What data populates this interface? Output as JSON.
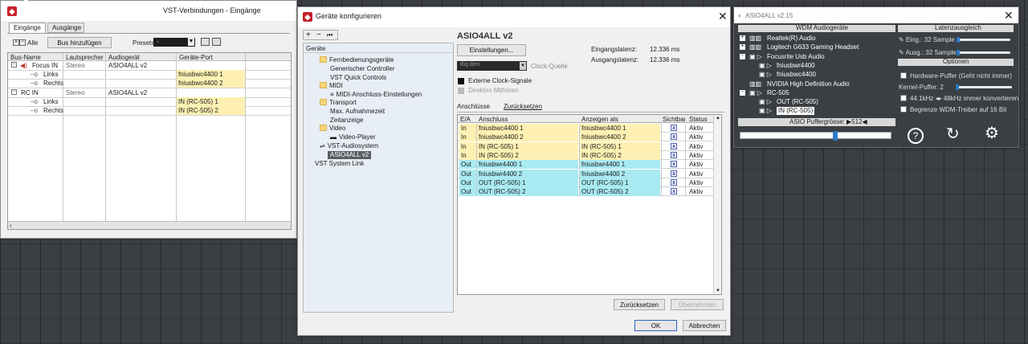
{
  "vst_window": {
    "title": "VST-Verbindungen - Eingänge",
    "tabs": [
      "Eingänge",
      "Ausgänge"
    ],
    "all_label": "Alle",
    "add_bus": "Bus hinzufügen",
    "presets_label": "Presets",
    "headers": [
      "Bus-Name",
      "Lautsprecher",
      "Audiogerät",
      "Geräte-Port"
    ],
    "rows": [
      {
        "name": "Focus IN",
        "speaker": "Stereo",
        "device": "ASIO4ALL v2",
        "port": ""
      },
      {
        "name": "Links",
        "speaker": "",
        "device": "",
        "port": "fniusbwc4400 1"
      },
      {
        "name": "Rechts",
        "speaker": "",
        "device": "",
        "port": "fniusbwc4400 2"
      },
      {
        "name": "RC IN",
        "speaker": "Stereo",
        "device": "ASIO4ALL v2",
        "port": ""
      },
      {
        "name": "Links",
        "speaker": "",
        "device": "",
        "port": "IN (RC-505) 1"
      },
      {
        "name": "Rechts",
        "speaker": "",
        "device": "",
        "port": "IN (RC-505) 2"
      }
    ]
  },
  "config_window": {
    "title": "Geräte konfigurieren",
    "tree_header": "Geräte",
    "tree": [
      {
        "label": "Fernbedienungsgeräte",
        "kind": "folder"
      },
      {
        "label": "Generischer Controller",
        "kind": "item"
      },
      {
        "label": "VST Quick Controls",
        "kind": "item"
      },
      {
        "label": "MIDI",
        "kind": "folder"
      },
      {
        "label": "MIDI-Anschluss-Einstellungen",
        "kind": "midi"
      },
      {
        "label": "Transport",
        "kind": "folder"
      },
      {
        "label": "Max. Aufnahmezeit",
        "kind": "item"
      },
      {
        "label": "Zeitanzeige",
        "kind": "item"
      },
      {
        "label": "Video",
        "kind": "folder"
      },
      {
        "label": "Video-Player",
        "kind": "video"
      },
      {
        "label": "VST-Audiosystem",
        "kind": "audio"
      },
      {
        "label": "ASIO4ALL v2",
        "kind": "selected"
      },
      {
        "label": "VST System Link",
        "kind": "top"
      }
    ],
    "device_title": "ASIO4ALL v2",
    "settings_button": "Einstellungen...",
    "input_latency_label": "Eingangslatenz:",
    "input_latency_value": "12.336 ms",
    "output_latency_label": "Ausgangslatenz:",
    "output_latency_value": "12.336 ms",
    "clock_source_value": "Big Ben",
    "clock_source_label": "Clock-Quelle",
    "external_clock": "Externe Clock-Signale",
    "direct_monitoring": "Direktes Mithören",
    "tab_ports": "Anschlüsse",
    "tab_reset": "Zurücksetzen",
    "port_headers": [
      "E/A",
      "Anschluss",
      "Anzeigen als",
      "Sichtbar",
      "Status"
    ],
    "ports": [
      {
        "io": "In",
        "port": "fniusbwc4400 1",
        "display": "fniusbwc4400 1",
        "visible": "x",
        "status": "Aktiv"
      },
      {
        "io": "In",
        "port": "fniusbwc4400 2",
        "display": "fniusbwc4400 2",
        "visible": "x",
        "status": "Aktiv"
      },
      {
        "io": "In",
        "port": "IN (RC-505) 1",
        "display": "IN (RC-505) 1",
        "visible": "x",
        "status": "Aktiv"
      },
      {
        "io": "In",
        "port": "IN (RC-505) 2",
        "display": "IN (RC-505) 2",
        "visible": "x",
        "status": "Aktiv"
      },
      {
        "io": "Out",
        "port": "fniusbwr4400 1",
        "display": "fniusbwr4400 1",
        "visible": "x",
        "status": "Aktiv"
      },
      {
        "io": "Out",
        "port": "fniusbwr4400 2",
        "display": "fniusbwr4400 2",
        "visible": "x",
        "status": "Aktiv"
      },
      {
        "io": "Out",
        "port": "OUT (RC-505) 1",
        "display": "OUT (RC-505) 1",
        "visible": "x",
        "status": "Aktiv"
      },
      {
        "io": "Out",
        "port": "OUT (RC-505) 2",
        "display": "OUT (RC-505) 2",
        "visible": "x",
        "status": "Aktiv"
      }
    ],
    "reset_button": "Zurücksetzen",
    "apply_button": "Übernehmen",
    "ok_button": "OK",
    "cancel_button": "Abbrechen"
  },
  "asio_window": {
    "title": "ASIO4ALL v2.15",
    "wdm_header": "WDM Audiogeräte",
    "latency_header": "Latenzausgleich",
    "devices": [
      {
        "label": "Realtek(R) Audio",
        "level": 0,
        "sign": "+"
      },
      {
        "label": "Logitech G633 Gaming Headset",
        "level": 0,
        "sign": "+"
      },
      {
        "label": "Focusrite Usb Audio",
        "level": 0,
        "sign": "-"
      },
      {
        "label": "fniusbwr4400",
        "level": 1,
        "sign": ""
      },
      {
        "label": "fniusbwc4400",
        "level": 1,
        "sign": ""
      },
      {
        "label": "NVIDIA High Definition Audio",
        "level": 0,
        "sign": ""
      },
      {
        "label": "RC-505",
        "level": 0,
        "sign": "-"
      },
      {
        "label": "OUT (RC-505)",
        "level": 1,
        "sign": ""
      },
      {
        "label": "IN (RC-505)",
        "level": 1,
        "sign": ""
      }
    ],
    "input_latency": "Eing.: 32 Sample",
    "output_latency": "Ausg.: 32 Sample",
    "options_header": "Optionen",
    "hw_buffer": "Hardware-Puffer (Geht nicht immer)",
    "kernel_buffer": "Kernel-Puffer: 2",
    "convert": "44.1kHz ◂▸ 48kHz immer konvertieren",
    "limit": "Begrenze WDM-Treiber auf 16 Bit",
    "buffer_size": "ASIO Puffergrösse: ▶512◀",
    "buffer_fraction": 0.63,
    "accent": "#2b79c8"
  }
}
